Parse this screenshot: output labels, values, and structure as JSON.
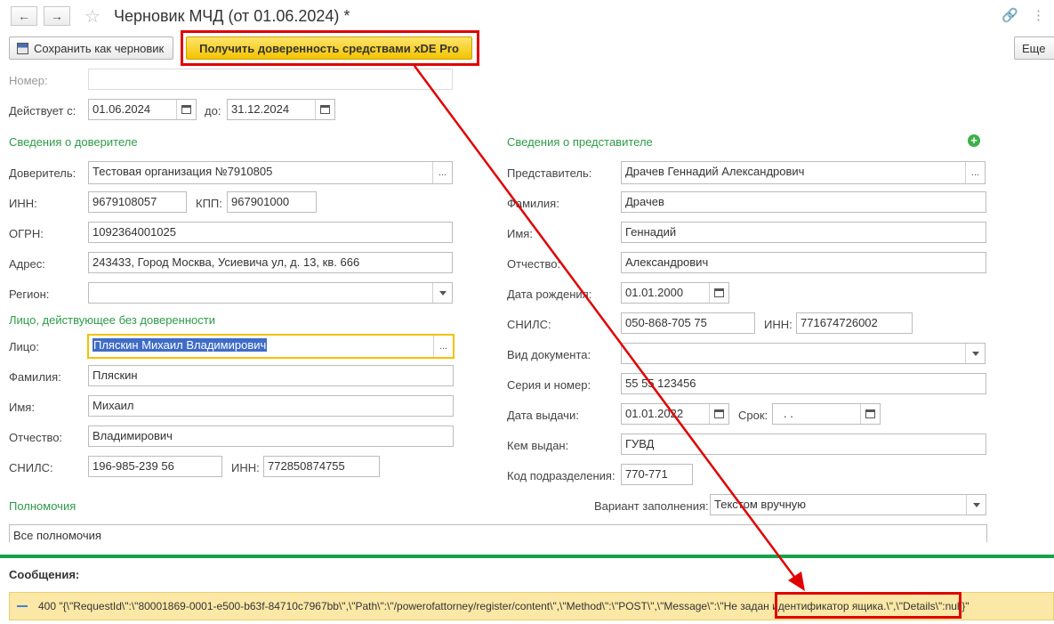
{
  "window": {
    "title": "Черновик МЧД (от 01.06.2024) *"
  },
  "toolbar": {
    "save_draft_label": "Сохранить как черновик",
    "get_poa_label": "Получить доверенность средствами xDE Pro",
    "more_label": "Еще"
  },
  "form": {
    "number_label": "Номер:",
    "number_value": "",
    "valid_from_label": "Действует с:",
    "valid_from": "01.06.2024",
    "valid_to_label": "до:",
    "valid_to": "31.12.2024"
  },
  "principal": {
    "section_title": "Сведения о доверителе",
    "principal_label": "Доверитель:",
    "principal_value": "Тестовая организация №7910805",
    "inn_label": "ИНН:",
    "inn": "9679108057",
    "kpp_label": "КПП:",
    "kpp": "967901000",
    "ogrn_label": "ОГРН:",
    "ogrn": "1092364001025",
    "address_label": "Адрес:",
    "address": "243433, Город Москва, Усиевича ул, д. 13, кв. 666",
    "region_label": "Регион:",
    "region": ""
  },
  "signer": {
    "section_title": "Лицо, действующее без доверенности",
    "person_label": "Лицо:",
    "person": "Пляскин Михаил Владимирович",
    "surname_label": "Фамилия:",
    "surname": "Пляскин",
    "name_label": "Имя:",
    "name": "Михаил",
    "patronymic_label": "Отчество:",
    "patronymic": "Владимирович",
    "snils_label": "СНИЛС:",
    "snils": "196-985-239 56",
    "inn_label": "ИНН:",
    "inn": "772850874755"
  },
  "representative": {
    "section_title": "Сведения о представителе",
    "rep_label": "Представитель:",
    "rep": "Драчев Геннадий Александрович",
    "surname_label": "Фамилия:",
    "surname": "Драчев",
    "name_label": "Имя:",
    "name": "Геннадий",
    "patronymic_label": "Отчество:",
    "patronymic": "Александрович",
    "birth_label": "Дата рождения:",
    "birth": "01.01.2000",
    "snils_label": "СНИЛС:",
    "snils": "050-868-705 75",
    "inn_label": "ИНН:",
    "inn": "771674726002",
    "doc_type_label": "Вид документа:",
    "doc_type": "",
    "series_label": "Серия и номер:",
    "series": "55 55 123456",
    "issue_date_label": "Дата выдачи:",
    "issue_date": "01.01.2022",
    "term_label": "Срок:",
    "term": " .  .",
    "issued_by_label": "Кем выдан:",
    "issued_by": "ГУВД",
    "dept_code_label": "Код подразделения:",
    "dept_code": "770-771"
  },
  "powers": {
    "section_title": "Полномочия",
    "fill_variant_label": "Вариант заполнения:",
    "fill_variant": "Текстом вручную",
    "text": "Все полномочия"
  },
  "messages": {
    "title": "Сообщения:",
    "line_prefix": "400 \"{\\\"RequestId\\\":\\\"80001869-0001-e500-b63f-84710c7967bb\\\",\\\"Path\\\":\\\"/powerofattorney/register/content\\\",\\\"Method\\\":\\\"POST\\\",\\\"Message\\\":",
    "line_highlight": "\\\"Не задан идентификатор ящика.\\\"",
    "line_suffix": ",\\\"Details\\\":null}\""
  },
  "colors": {
    "section_green": "#2e9a4a",
    "highlight_red": "#e00000",
    "button_yellow": "#f4c400",
    "message_bg": "#fbe8a6"
  }
}
